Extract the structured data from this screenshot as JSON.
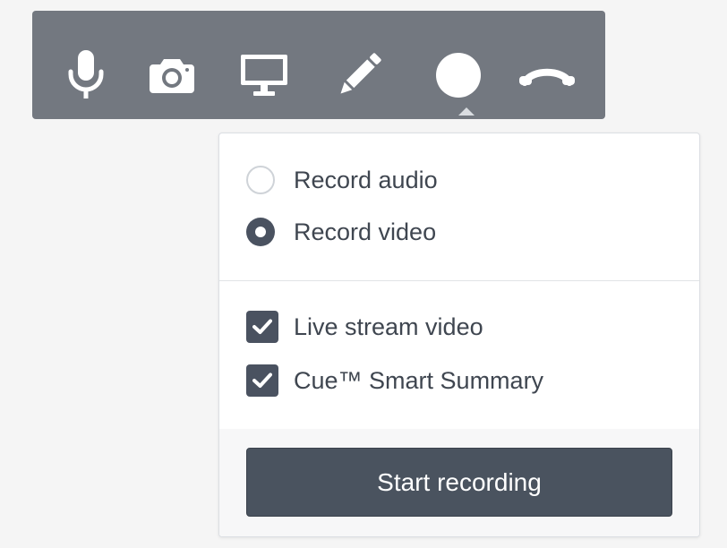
{
  "toolbar": {
    "tools": [
      {
        "name": "microphone",
        "icon": "microphone-icon"
      },
      {
        "name": "camera",
        "icon": "camera-icon"
      },
      {
        "name": "screen-share",
        "icon": "monitor-icon"
      },
      {
        "name": "annotate",
        "icon": "pencil-icon"
      },
      {
        "name": "record",
        "icon": "record-circle-icon"
      },
      {
        "name": "hang-up",
        "icon": "phone-hangup-icon"
      }
    ],
    "background_color": "#737880",
    "icon_color": "#ffffff"
  },
  "recording_menu": {
    "modes": [
      {
        "label": "Record audio",
        "selected": false
      },
      {
        "label": "Record video",
        "selected": true
      }
    ],
    "options": [
      {
        "label": "Live stream video",
        "checked": true
      },
      {
        "label": "Cue™ Smart Summary",
        "checked": true
      }
    ],
    "start_button_label": "Start recording",
    "accent_color": "#4a5260"
  }
}
